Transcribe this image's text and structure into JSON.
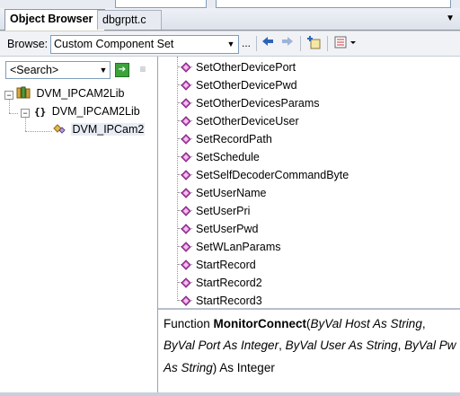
{
  "tabs": [
    {
      "label": "Object Browser",
      "active": true
    },
    {
      "label": "dbgrptt.c",
      "active": false
    }
  ],
  "toolbar": {
    "browse_label": "Browse:",
    "browse_value": "Custom Component Set",
    "ellipsis": "...",
    "back_icon": "arrow-left-icon",
    "forward_icon": "arrow-right-icon"
  },
  "search": {
    "placeholder": "<Search>"
  },
  "tree": [
    {
      "label": "DVM_IPCAM2Lib",
      "icon": "library-icon",
      "expander": "−"
    },
    {
      "label": "DVM_IPCAM2Lib",
      "icon": "namespace-icon",
      "expander": "−"
    },
    {
      "label": "DVM_IPCam2",
      "icon": "class-icon",
      "selected": true
    }
  ],
  "members": [
    "SetOtherDevicePort",
    "SetOtherDevicePwd",
    "SetOtherDevicesParams",
    "SetOtherDeviceUser",
    "SetRecordPath",
    "SetSchedule",
    "SetSelfDecoderCommandByte",
    "SetUserName",
    "SetUserPri",
    "SetUserPwd",
    "SetWLanParams",
    "StartRecord",
    "StartRecord2",
    "StartRecord3"
  ],
  "description": {
    "prefix": "Function ",
    "name": "MonitorConnect",
    "open": "(",
    "p1": "ByVal Host As String",
    "comma1": ",",
    "p2": "ByVal Port As Integer",
    "comma2": ",",
    "p3": "ByVal User As String",
    "comma3": ",",
    "p4a": "ByVal Pw",
    "p4b": "As String",
    "close": ") As Integer"
  },
  "colors": {
    "accent": "#3a6fc4",
    "method_icon": "#c94fc1"
  }
}
